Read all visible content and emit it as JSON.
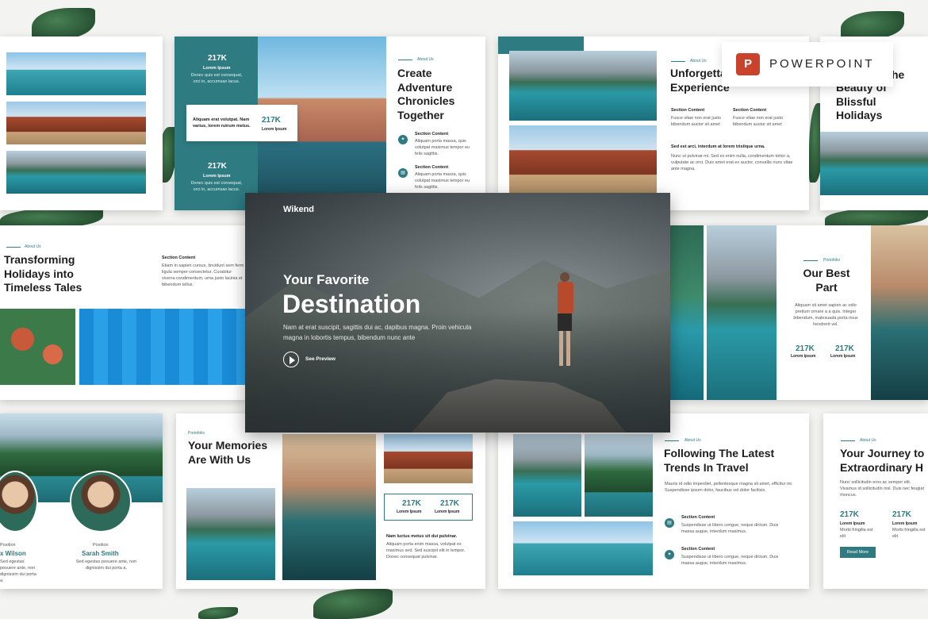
{
  "powerpoint": {
    "label": "POWERPOINT",
    "icon": "powerpoint-icon",
    "accent": "#c9432c"
  },
  "accent": "#2e7b82",
  "hero": {
    "brand": "Wikend",
    "subtitle": "Your Favorite",
    "title": "Destination",
    "body": "Nam at erat suscipit, sagittis dui ac, dapibus magna. Proin vehicula magna in lobortis tempus, bibendum nunc ante",
    "cta": "See Preview",
    "cta_icon": "play-icon"
  },
  "slide_adventure": {
    "stat1": "217K",
    "stat1_label": "Lorem Ipsum",
    "stat1_body": "Donec quis est consequat, orci in, accumsan lacus.",
    "card_body": "Aliquam erat volutpat. Nam varius, lorem rutrum metus.",
    "card_stat": "217K",
    "card_stat_label": "Lorem Ipsum",
    "stat2": "217K",
    "stat2_label": "Lorem Ipsum",
    "stat2_body": "Donec quis est consequat, orci in, accumsan lacus.",
    "kicker": "About Us",
    "title": "Create Adventure Chronicles Together",
    "sec1_title": "Section Content",
    "sec1_body": "Aliquam porta massa, quis volutpat maximus tempor eu felis sagittis.",
    "sec2_title": "Section Content",
    "sec2_body": "Aliquam porta massa, quis volutpat maximus tempor eu felis sagittis."
  },
  "slide_unforget": {
    "kicker": "About Us",
    "title": "Unforgettable Holiday Experience",
    "col1_title": "Section Content",
    "col1_body": "Fusce vitae non erat justo bibendum auctor sit amet",
    "col2_title": "Section Content",
    "col2_body": "Fusce vitae non erat justo bibendum auctor sit amet",
    "head": "Sed est arci, interdum at lorem tristique urna.",
    "body": "Nunc ut pulvinar mi. Sed ex enim nulla, condimentum tortor a, vulputate ac orci. Duis amet erat ex auctor, convallis nunc vitae ante magna."
  },
  "slide_beauty": {
    "title": "Beauty of Blissful Holidays",
    "title_fragment": "he"
  },
  "slide_transform": {
    "kicker": "About Us",
    "title": "Transforming Holidays into Timeless Tales",
    "sec_title": "Section Content",
    "sec_body": "Etiam in sapien cursus, tincidunt sem ferm ligula semper consectetur. Curabitur viverra condimentum, urna justo lacinia et bibendum tellus."
  },
  "slide_best": {
    "kicker": "Portofolio",
    "title": "Our Best Part",
    "body": "Aliquam sit amet sapien ac odio pretium ornare a a quis. Integer bibendum, malesuada porta risus hendrerit vel.",
    "stat1": "217K",
    "stat1_label": "Lorem Ipsum",
    "stat2": "217K",
    "stat2_label": "Lorem Ipsum"
  },
  "slide_team": {
    "p1_role": "Position",
    "p1_name": "x Wilson",
    "p1_body": "Sed egestas posuere ante, non dignissim dui porta a.",
    "p2_role": "Position",
    "p2_name": "Sarah Smith",
    "p2_body": "Sed egestas posuere ante, non dignissim dui porta a."
  },
  "slide_memories": {
    "kicker": "Portofolio",
    "title": "Your Memories Are With Us",
    "stat1": "217K",
    "stat1_label": "Lorem Ipsum",
    "stat2": "217K",
    "stat2_label": "Lorem Ipsum",
    "head": "Nam luctus metus sit dui pulvinar.",
    "body": "Aliquam porta enim massa, volutpat ex maximus sed. Sed suscipit elit in tempor. Donec consequat pulvinar."
  },
  "slide_trends": {
    "kicker": "About Us",
    "title": "Following The Latest Trends In Travel",
    "body": "Mauris id odio imperdiet, pellentesque magna sit amet, efficitur mi. Suspendisse ipsum dolor, faucibus vel dolor facilisis.",
    "sec1_title": "Section Content",
    "sec1_body": "Suspendisse ut libero congue, neque dictum, Duis massa augue, interdum maximus.",
    "sec2_title": "Section Content",
    "sec2_body": "Suspendisse ut libero congue, neque dictum, Duis massa augue, interdum maximus."
  },
  "slide_journey": {
    "kicker": "About Us",
    "title": "Your Journey to Extraordinary H",
    "body": "Nunc sollicitudin eros ac semper elit. Vivamus id sollicitudin nisl. Duis nec feugiat rhoncus.",
    "stat1": "217K",
    "stat1_label": "Lorem Ipsum",
    "stat1_body": "Morbi fringilla est elit",
    "stat2": "217K",
    "stat2_label": "Lorem Ipsum",
    "stat2_body": "Morbi fringilla est elit",
    "button": "Read More"
  }
}
